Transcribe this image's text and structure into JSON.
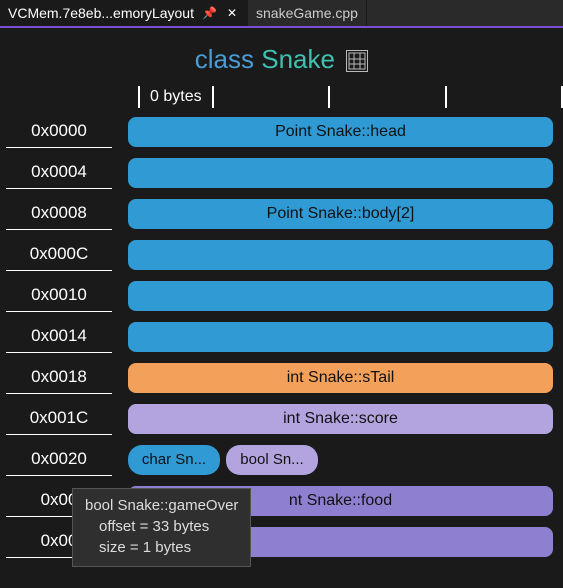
{
  "tabs": {
    "active": {
      "label": "VCMem.7e8eb...emoryLayout"
    },
    "other": {
      "label": "snakeGame.cpp"
    }
  },
  "heading": {
    "keyword": "class",
    "name": "Snake"
  },
  "ruler": {
    "label": "0 bytes"
  },
  "rows": [
    {
      "addr": "0x0000",
      "type": "bar",
      "color": "c-blue",
      "label": "Point Snake::head"
    },
    {
      "addr": "0x0004",
      "type": "bar",
      "color": "c-blue",
      "label": ""
    },
    {
      "addr": "0x0008",
      "type": "bar",
      "color": "c-blue",
      "label": "Point Snake::body[2]"
    },
    {
      "addr": "0x000C",
      "type": "bar",
      "color": "c-blue",
      "label": ""
    },
    {
      "addr": "0x0010",
      "type": "bar",
      "color": "c-blue",
      "label": ""
    },
    {
      "addr": "0x0014",
      "type": "bar",
      "color": "c-blue",
      "label": ""
    },
    {
      "addr": "0x0018",
      "type": "bar",
      "color": "c-orange",
      "label": "int Snake::sTail"
    },
    {
      "addr": "0x001C",
      "type": "bar",
      "color": "c-lilac",
      "label": "int Snake::score"
    },
    {
      "addr": "0x0020",
      "type": "chips",
      "chips": [
        {
          "color": "c-blue",
          "label": "char Sn...",
          "w": 92
        },
        {
          "color": "c-lilac",
          "label": "bool Sn...",
          "w": 92
        }
      ]
    },
    {
      "addr": "0x00",
      "type": "bar",
      "color": "c-violet",
      "label": "nt Snake::food"
    },
    {
      "addr": "0x00",
      "type": "bar",
      "color": "c-violet",
      "label": ""
    }
  ],
  "tooltip": {
    "line1": "bool Snake::gameOver",
    "line2": "offset = 33 bytes",
    "line3": "size = 1 bytes"
  }
}
